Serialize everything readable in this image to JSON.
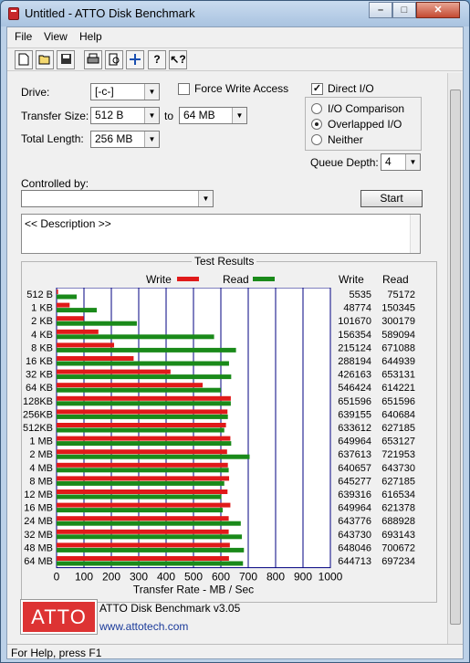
{
  "window": {
    "title": "Untitled - ATTO Disk Benchmark"
  },
  "menu": [
    "File",
    "View",
    "Help"
  ],
  "toolbar": {
    "icons": [
      "new-file-icon",
      "open-folder-icon",
      "save-icon",
      "print-icon",
      "print-preview-icon",
      "move-icon",
      "help-icon",
      "context-help-icon"
    ]
  },
  "settings": {
    "drive_label": "Drive:",
    "drive_value": "[-c-]",
    "transfer_size_label": "Transfer Size:",
    "transfer_from": "512 B",
    "to_label": "to",
    "transfer_to": "64 MB",
    "total_length_label": "Total Length:",
    "total_length_value": "256 MB",
    "force_write_label": "Force Write Access",
    "force_write_checked": false,
    "direct_io_label": "Direct I/O",
    "direct_io_checked": true,
    "io_comparison_label": "I/O Comparison",
    "overlapped_io_label": "Overlapped I/O",
    "neither_label": "Neither",
    "selected_io_mode": "overlapped",
    "queue_depth_label": "Queue Depth:",
    "queue_depth_value": "4",
    "controlled_by_label": "Controlled by:",
    "controlled_by_value": "",
    "start_label": "Start",
    "description_text": "<< Description >>"
  },
  "results": {
    "title": "Test Results",
    "legend_write": "Write",
    "legend_read": "Read",
    "col_write": "Write",
    "col_read": "Read",
    "colors": {
      "write": "#e01a1a",
      "read": "#1a8a1a",
      "grid": "#000080"
    }
  },
  "chart_data": {
    "type": "bar",
    "orientation": "horizontal",
    "xlabel": "Transfer Rate - MB / Sec",
    "xlim": [
      0,
      1000
    ],
    "xticks": [
      0,
      100,
      200,
      300,
      400,
      500,
      600,
      700,
      800,
      900,
      1000
    ],
    "categories": [
      "512 B",
      "1 KB",
      "2 KB",
      "4 KB",
      "8 KB",
      "16 KB",
      "32 KB",
      "64 KB",
      "128KB",
      "256KB",
      "512KB",
      "1 MB",
      "2 MB",
      "4 MB",
      "8 MB",
      "12 MB",
      "16 MB",
      "24 MB",
      "32 MB",
      "48 MB",
      "64 MB"
    ],
    "series": [
      {
        "name": "Write",
        "values": [
          5535,
          48774,
          101670,
          156354,
          215124,
          288194,
          426163,
          546424,
          651596,
          639155,
          633612,
          649964,
          637613,
          640657,
          645277,
          639316,
          649964,
          643776,
          643730,
          648046,
          644713
        ]
      },
      {
        "name": "Read",
        "values": [
          75172,
          150345,
          300179,
          589094,
          671088,
          644939,
          653131,
          614221,
          651596,
          640684,
          627185,
          653127,
          721953,
          643730,
          627185,
          616534,
          621378,
          688928,
          693143,
          700672,
          697234
        ]
      }
    ]
  },
  "footer": {
    "product": "ATTO Disk Benchmark v3.05",
    "url": "www.attotech.com",
    "logo_text": "ATTO"
  },
  "status": {
    "text": "For Help, press F1"
  }
}
